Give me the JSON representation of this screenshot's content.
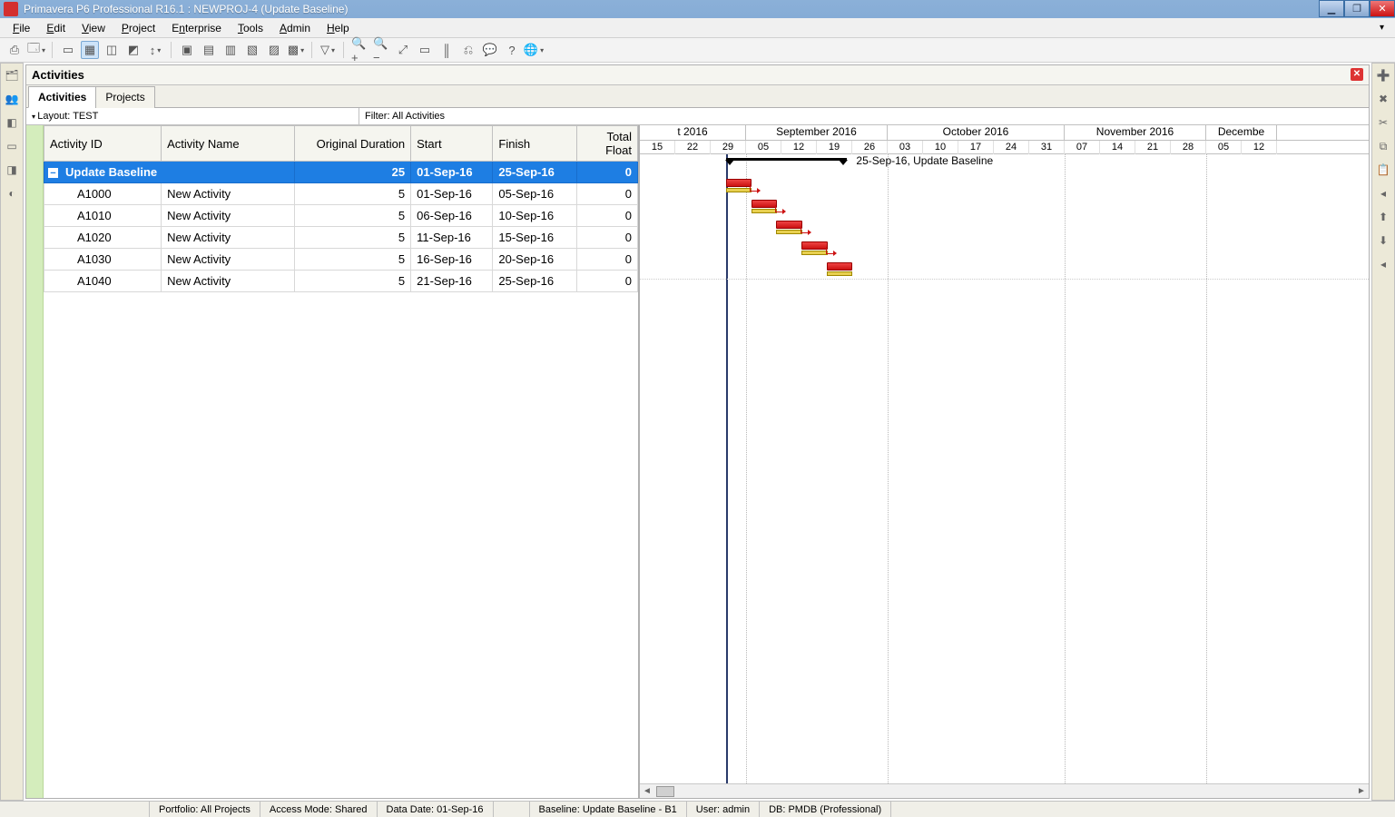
{
  "window": {
    "title": "Primavera P6 Professional R16.1 : NEWPROJ-4 (Update Baseline)"
  },
  "menu": {
    "file": "File",
    "edit": "Edit",
    "view": "View",
    "project": "Project",
    "enterprise": "Enterprise",
    "tools": "Tools",
    "admin": "Admin",
    "help": "Help"
  },
  "panel": {
    "title": "Activities",
    "close": "✕"
  },
  "tabs": {
    "activities": "Activities",
    "projects": "Projects"
  },
  "subheader": {
    "layout": "Layout: TEST",
    "filter": "Filter: All Activities"
  },
  "columns": {
    "id": "Activity ID",
    "name": "Activity Name",
    "duration": "Original Duration",
    "start": "Start",
    "finish": "Finish",
    "float": "Total Float"
  },
  "group": {
    "expand": "−",
    "name": "Update Baseline",
    "duration": "25",
    "start": "01-Sep-16",
    "finish": "25-Sep-16",
    "float": "0"
  },
  "rows": [
    {
      "id": "A1000",
      "name": "New Activity",
      "duration": "5",
      "start": "01-Sep-16",
      "finish": "05-Sep-16",
      "float": "0"
    },
    {
      "id": "A1010",
      "name": "New Activity",
      "duration": "5",
      "start": "06-Sep-16",
      "finish": "10-Sep-16",
      "float": "0"
    },
    {
      "id": "A1020",
      "name": "New Activity",
      "duration": "5",
      "start": "11-Sep-16",
      "finish": "15-Sep-16",
      "float": "0"
    },
    {
      "id": "A1030",
      "name": "New Activity",
      "duration": "5",
      "start": "16-Sep-16",
      "finish": "20-Sep-16",
      "float": "0"
    },
    {
      "id": "A1040",
      "name": "New Activity",
      "duration": "5",
      "start": "21-Sep-16",
      "finish": "25-Sep-16",
      "float": "0"
    }
  ],
  "timeline": {
    "partial_month": "t 2016",
    "months": [
      {
        "label": "September 2016",
        "weeks": 4
      },
      {
        "label": "October 2016",
        "weeks": 5
      },
      {
        "label": "November 2016",
        "weeks": 4
      },
      {
        "label": "Decembe",
        "weeks": 2
      }
    ],
    "days": [
      "15",
      "22",
      "29",
      "05",
      "12",
      "19",
      "26",
      "03",
      "10",
      "17",
      "24",
      "31",
      "07",
      "14",
      "21",
      "28",
      "05",
      "12"
    ],
    "summary_label": "25-Sep-16, Update Baseline"
  },
  "statusbar": {
    "portfolio": "Portfolio: All Projects",
    "access": "Access Mode: Shared",
    "datadate": "Data Date: 01-Sep-16",
    "baseline": "Baseline: Update Baseline - B1",
    "user": "User: admin",
    "db": "DB: PMDB (Professional)"
  }
}
